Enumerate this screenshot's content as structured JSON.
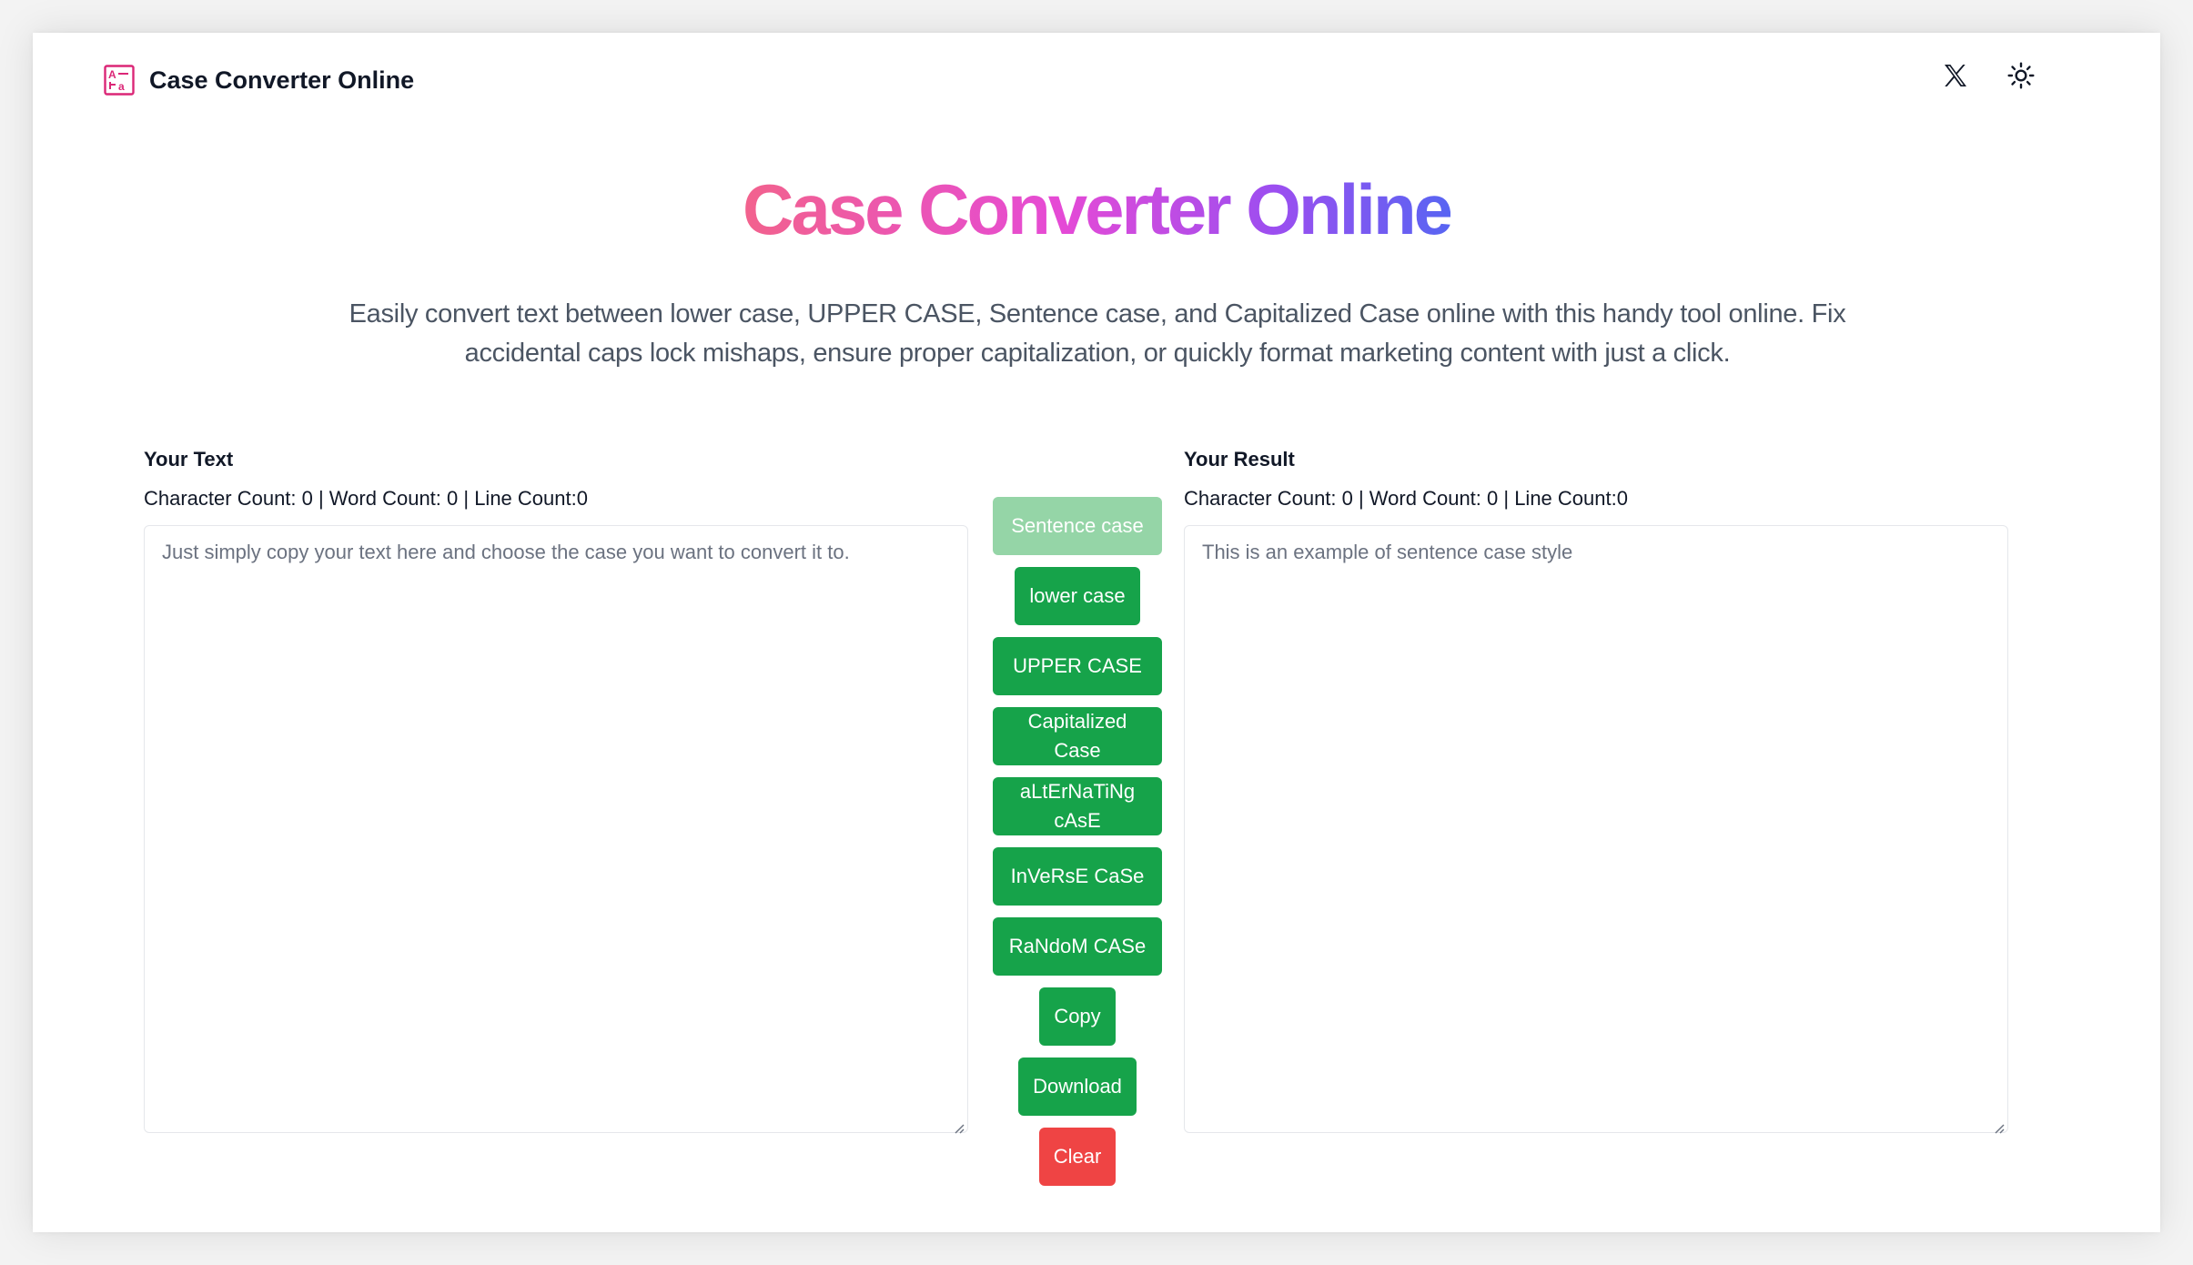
{
  "header": {
    "brand": "Case Converter Online",
    "icons": [
      "case-converter-logo-icon",
      "x-twitter-icon",
      "sun-icon"
    ]
  },
  "hero": {
    "title": "Case Converter Online",
    "description": "Easily convert text between lower case, UPPER CASE, Sentence case, and Capitalized Case online with this handy tool online. Fix accidental caps lock mishaps, ensure proper capitalization, or quickly format marketing content with just a click."
  },
  "input_panel": {
    "label": "Your Text",
    "counts": "Character Count: 0 | Word Count: 0 | Line Count:0",
    "value": "",
    "placeholder": "Just simply copy your text here and choose the case you want to convert it to."
  },
  "result_panel": {
    "label": "Your Result",
    "counts": "Character Count: 0 | Word Count: 0 | Line Count:0",
    "value": "",
    "placeholder": "This is an example of sentence case style"
  },
  "buttons": {
    "sentence": "Sentence case",
    "lower": "lower case",
    "upper": "UPPER CASE",
    "capitalized": "Capitalized Case",
    "alternating": "aLtErNaTiNg cAsE",
    "inverse": "InVeRsE CaSe",
    "random": "RaNdoM CASe",
    "copy": "Copy",
    "download": "Download",
    "clear": "Clear"
  },
  "colors": {
    "primary_button": "#16a34a",
    "disabled_button": "#95d5a7",
    "clear_button": "#ef4444",
    "title_gradient": [
      "#f2628d",
      "#e54ad6",
      "#9c4ef0",
      "#5865f2"
    ]
  }
}
